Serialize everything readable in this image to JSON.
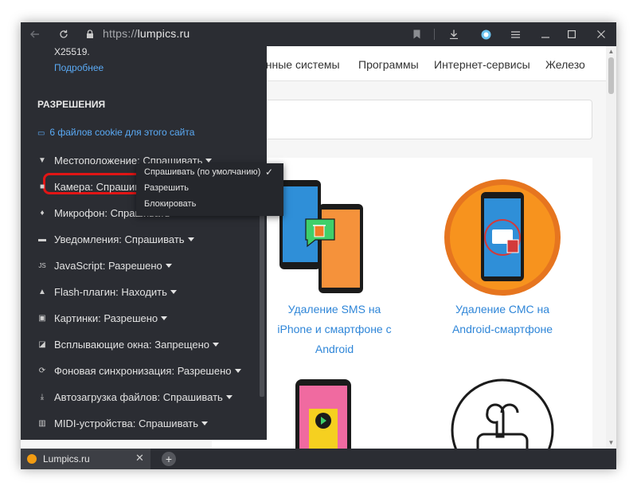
{
  "browser": {
    "url_scheme": "https://",
    "url_host": "lumpics.ru",
    "icons": [
      "back-icon",
      "reload-icon",
      "lock-icon",
      "bookmark-icon",
      "download-icon",
      "alice-icon",
      "menu-icon",
      "minimize-icon",
      "maximize-icon",
      "close-icon"
    ]
  },
  "site_nav": {
    "items": [
      "онные системы",
      "Программы",
      "Интернет-сервисы",
      "Железо"
    ]
  },
  "cards": [
    {
      "title_line1": "Удаление SMS на",
      "title_line2": "iPhone и смартфоне с",
      "title_line3": "Android"
    },
    {
      "title_line1": "Удаление СМС на",
      "title_line2": "Android-смартфоне"
    }
  ],
  "panel": {
    "key_text": "X25519.",
    "more_link": "Подробнее",
    "section_title": "РАЗРЕШЕНИЯ",
    "cookies_link": "6 файлов cookie для этого сайта",
    "permissions": [
      {
        "label": "Местоположение:",
        "value": "Спрашивать",
        "icon": "location-icon"
      },
      {
        "label": "Камера:",
        "value": "Спрашивать",
        "icon": "camera-icon"
      },
      {
        "label": "Микрофон:",
        "value": "Спрашивать",
        "icon": "microphone-icon"
      },
      {
        "label": "Уведомления:",
        "value": "Спрашивать",
        "icon": "notifications-icon"
      },
      {
        "label": "JavaScript:",
        "value": "Разрешено",
        "icon": "javascript-icon"
      },
      {
        "label": "Flash-плагин:",
        "value": "Находить",
        "icon": "flash-icon"
      },
      {
        "label": "Картинки:",
        "value": "Разрешено",
        "icon": "image-icon"
      },
      {
        "label": "Всплывающие окна:",
        "value": "Запрещено",
        "icon": "popup-icon"
      },
      {
        "label": "Фоновая синхронизация:",
        "value": "Разрешено",
        "icon": "sync-icon"
      },
      {
        "label": "Автозагрузка файлов:",
        "value": "Спрашивать",
        "icon": "download-icon"
      },
      {
        "label": "MIDI-устройства:",
        "value": "Спрашивать",
        "icon": "midi-icon"
      }
    ]
  },
  "dropdown": {
    "options": [
      "Спрашивать (по умолчанию)",
      "Разрешить",
      "Блокировать"
    ],
    "selected": "Спрашивать (по умолчанию)"
  },
  "tabs": [
    {
      "label": "Lumpics.ru"
    }
  ],
  "colors": {
    "accent_link": "#5aaaf5",
    "site_link": "#2f86d8",
    "highlight": "#e11515",
    "favicon": "#f39c12"
  }
}
